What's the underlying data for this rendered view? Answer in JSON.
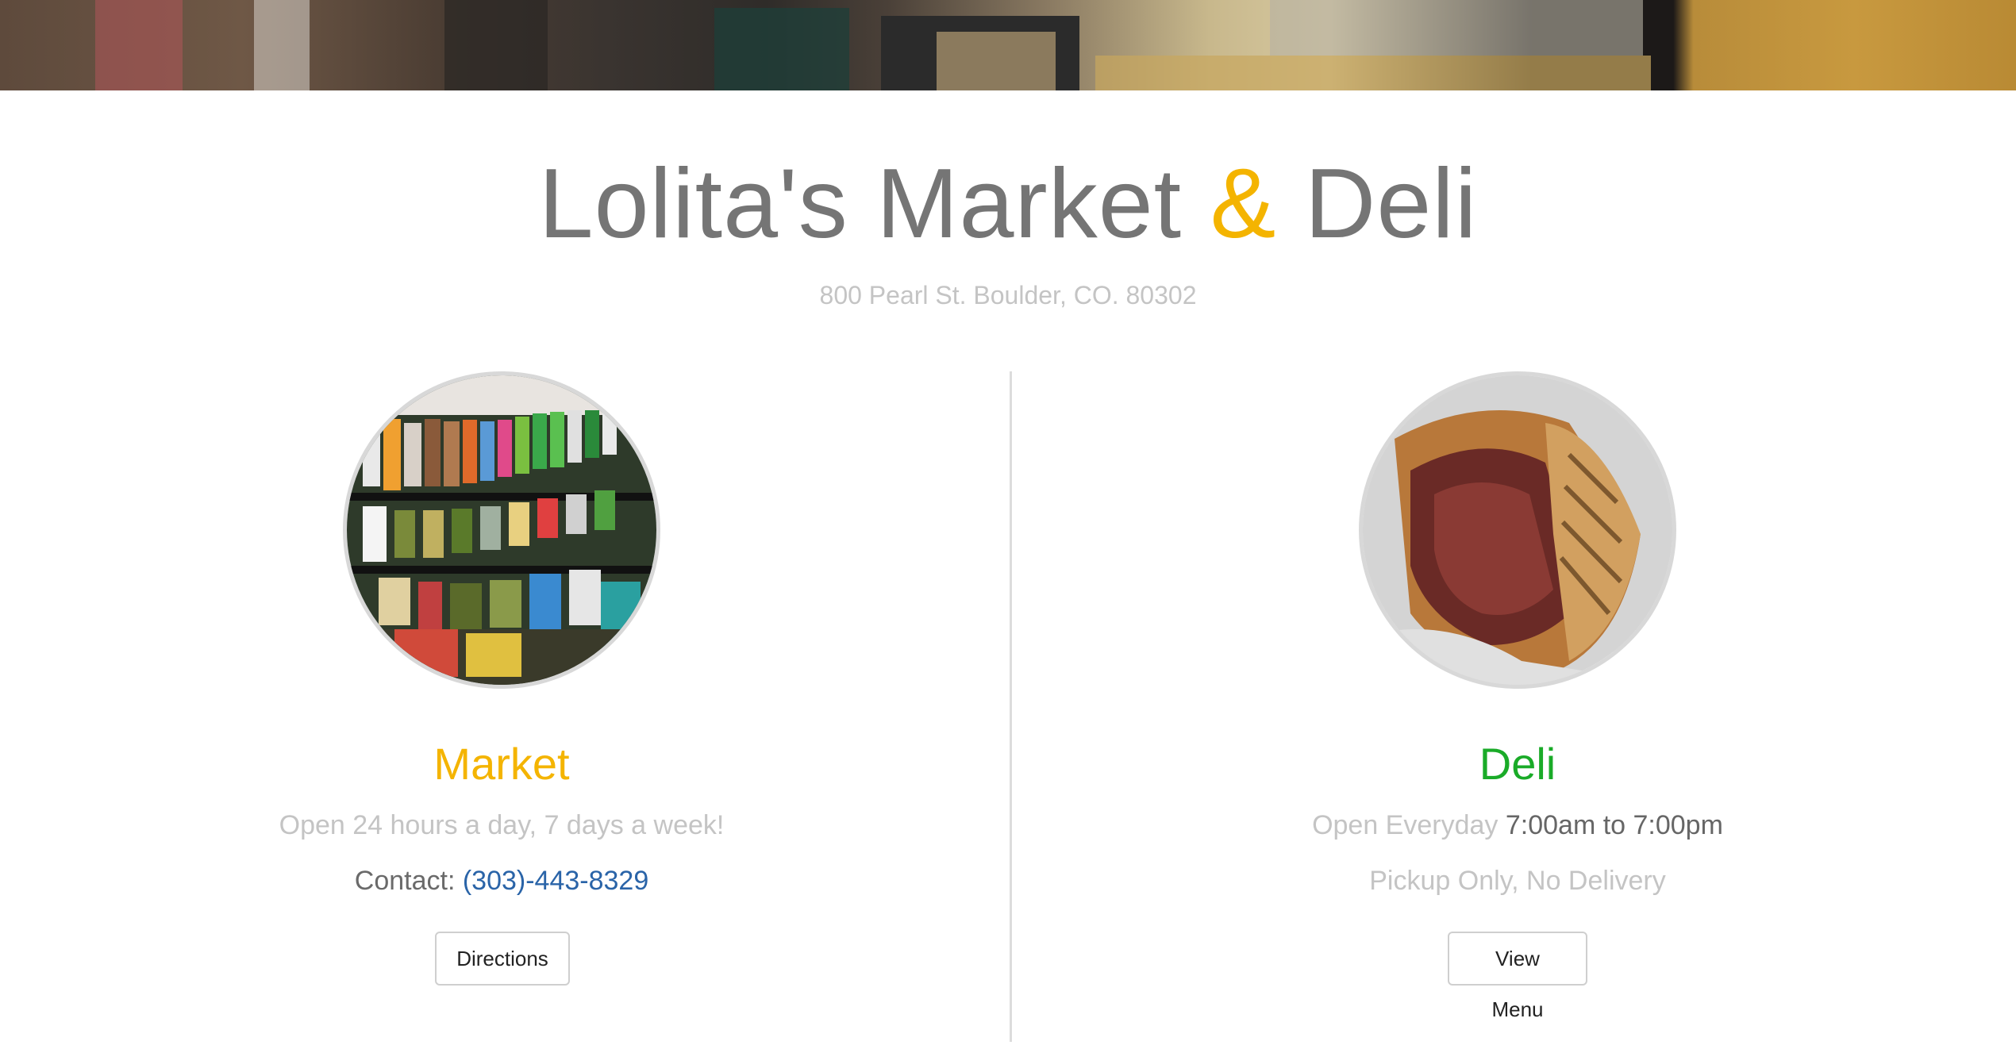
{
  "hero": {
    "image": "storefront-photo"
  },
  "header": {
    "title_part1": "Lolita's Market",
    "title_amp": "&",
    "title_part2": "Deli",
    "address": "800 Pearl St. Boulder, CO. 80302"
  },
  "market": {
    "image": "grocery-shelves-photo",
    "heading": "Market",
    "hours": "Open 24 hours a day, 7 days a week!",
    "contact_label": "Contact: ",
    "phone": "(303)-443-8329",
    "button_label": "Directions"
  },
  "deli": {
    "image": "reuben-sandwich-photo",
    "heading": "Deli",
    "hours_label": "Open Everyday ",
    "hours_time": "7:00am to 7:00pm",
    "note": "Pickup Only, No Delivery",
    "button_label": "View Menu"
  },
  "colors": {
    "accent_yellow": "#f4b400",
    "accent_green": "#1aab28",
    "link_blue": "#2a64a8",
    "title_gray": "#757575",
    "muted_gray": "#c4c4c4"
  }
}
